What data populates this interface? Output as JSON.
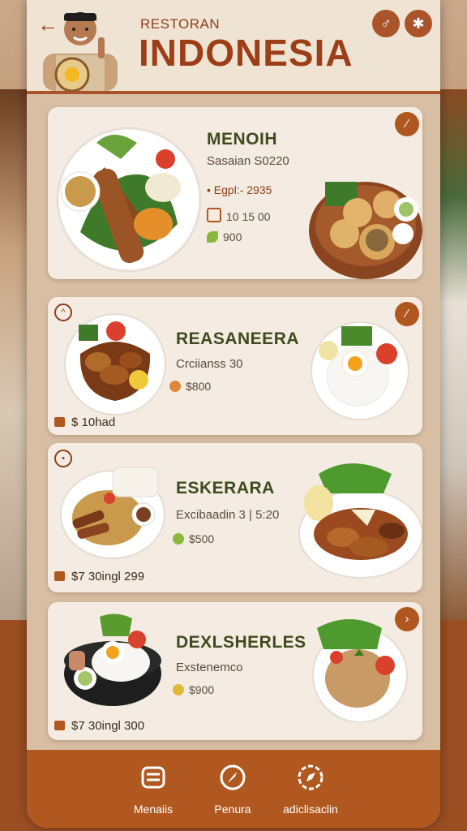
{
  "header": {
    "subtitle": "RESTORAN",
    "title": "INDONESIA"
  },
  "items": [
    {
      "title": "MENOIH",
      "subtitle": "Sasaian S0220",
      "line1": "• Egpl:- 2935",
      "line2": "10 15 00",
      "line3": "900"
    },
    {
      "title": "REASANEERA",
      "subtitle": "Crciianss 30",
      "line1": "$800",
      "price": "$ 10had"
    },
    {
      "title": "ESKERARA",
      "subtitle": "Excibaadin 3 | 5:20",
      "line1": "$500",
      "price": "$7 30ingl 299"
    },
    {
      "title": "DEXLSHERLES",
      "subtitle": "Exstenemco",
      "line1": "$900",
      "price": "$7 30ingl 300"
    }
  ],
  "nav": [
    {
      "label": "Menaiis",
      "icon": "menu-icon"
    },
    {
      "label": "Penura",
      "icon": "compass-icon"
    },
    {
      "label": "adiclisaclin",
      "icon": "explore-icon"
    }
  ],
  "colors": {
    "brand": "#9c3f18",
    "accent": "#b0571f",
    "title_green": "#3f4a1d",
    "card_bg": "#f4ece2"
  }
}
